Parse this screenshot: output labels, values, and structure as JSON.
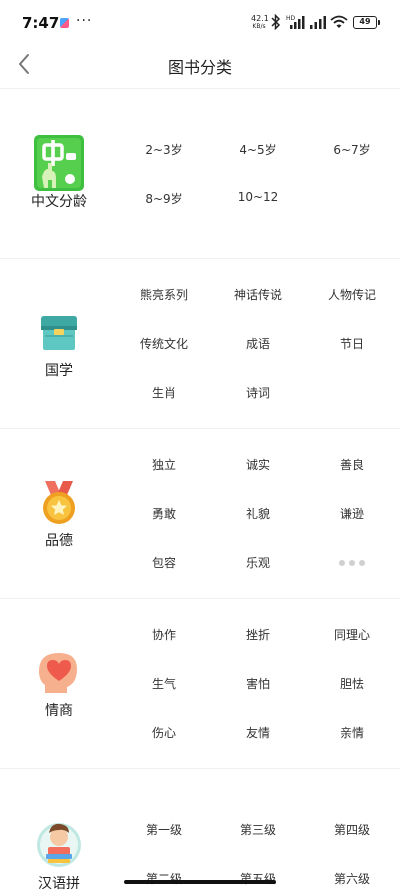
{
  "status_bar": {
    "time": "7:47",
    "more": "···",
    "net_speed_value": "42.1",
    "net_speed_unit": "KB/s",
    "hd_label": "HD",
    "battery": "49"
  },
  "header": {
    "title": "图书分类",
    "back_icon": "chevron-left-icon"
  },
  "sections": [
    {
      "label": "中文分龄",
      "icon": "chinese-age-icon",
      "options": [
        "2~3岁",
        "4~5岁",
        "6~7岁",
        "8~9岁",
        "10~12"
      ]
    },
    {
      "label": "国学",
      "icon": "treasure-box-icon",
      "options": [
        "熊亮系列",
        "神话传说",
        "人物传记",
        "传统文化",
        "成语",
        "节日",
        "生肖",
        "诗词"
      ]
    },
    {
      "label": "品德",
      "icon": "medal-icon",
      "options": [
        "独立",
        "诚实",
        "善良",
        "勇敢",
        "礼貌",
        "谦逊",
        "包容",
        "乐观"
      ],
      "has_more": true
    },
    {
      "label": "情商",
      "icon": "heart-head-icon",
      "options": [
        "协作",
        "挫折",
        "同理心",
        "生气",
        "害怕",
        "胆怯",
        "伤心",
        "友情",
        "亲情"
      ]
    },
    {
      "label": "汉语拼",
      "icon": "reading-boy-icon",
      "options": [
        "第一级",
        "第三级",
        "第四级",
        "第二级",
        "第五级",
        "第六级"
      ]
    }
  ],
  "colors": {
    "green": "#3fbf3f",
    "teal": "#4fb8b2",
    "medal_orange": "#f0a020",
    "heart_pink": "#f0906a"
  }
}
